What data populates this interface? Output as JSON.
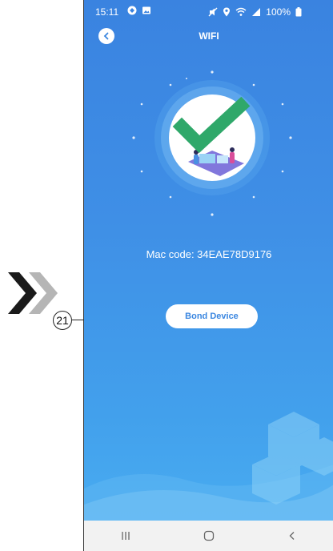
{
  "status": {
    "time": "15:11",
    "battery": "100%"
  },
  "header": {
    "title": "WIFI"
  },
  "device": {
    "mac_label": "Mac code: 34EAE78D9176"
  },
  "actions": {
    "bond_label": "Bond Device"
  },
  "annotation": {
    "number": "21"
  },
  "colors": {
    "primary": "#3a86e0",
    "check": "#2fa86a",
    "background_top": "#3a83e0",
    "background_bottom": "#4aaff2"
  },
  "icons": [
    "chevron-right-icon",
    "back-icon",
    "check-icon",
    "wifi-icon",
    "location-icon",
    "battery-icon",
    "recent-apps-icon",
    "home-icon",
    "back-nav-icon"
  ]
}
